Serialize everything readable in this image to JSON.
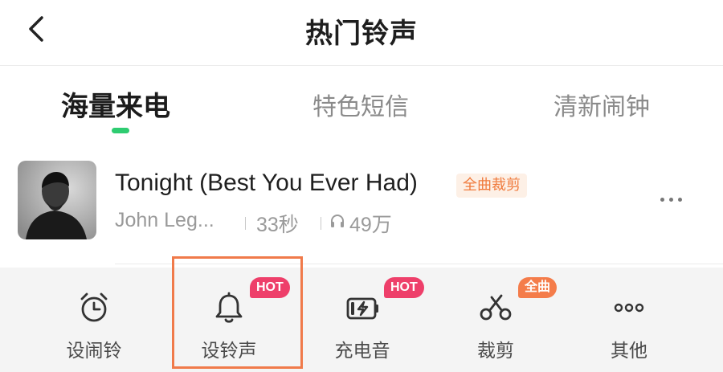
{
  "nav": {
    "title": "热门铃声",
    "back_icon": "chevron-left-icon"
  },
  "tabs": [
    {
      "label": "海量来电",
      "active": true
    },
    {
      "label": "特色短信",
      "active": false
    },
    {
      "label": "清新闹钟",
      "active": false
    }
  ],
  "song": {
    "title": "Tonight (Best You Ever Had)",
    "tag": "全曲裁剪",
    "artist": "John Leg...",
    "duration": "33秒",
    "plays": "49万",
    "plays_icon": "headphones-icon",
    "more_icon": "more-dots-icon"
  },
  "actions": [
    {
      "label": "设闹铃",
      "icon": "alarm-clock-icon",
      "badge": ""
    },
    {
      "label": "设铃声",
      "icon": "bell-icon",
      "badge": "HOT"
    },
    {
      "label": "充电音",
      "icon": "battery-charge-icon",
      "badge": "HOT"
    },
    {
      "label": "裁剪",
      "icon": "scissors-icon",
      "badge": "全曲"
    },
    {
      "label": "其他",
      "icon": "more-circles-icon",
      "badge": ""
    }
  ],
  "colors": {
    "accent_green": "#2ecc71",
    "tag_text": "#f07a3c",
    "tag_bg": "#fdf0e6",
    "badge_hot": "#ee3f6a",
    "badge_full": "#f47c4a",
    "highlight_box": "#f07a4a"
  }
}
